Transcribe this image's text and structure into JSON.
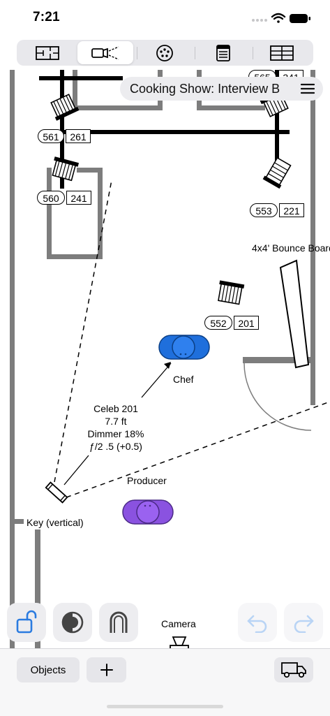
{
  "status_bar": {
    "time": "7:21"
  },
  "tabs": [
    {
      "icon": "floor-plan-icon",
      "selected": false
    },
    {
      "icon": "spotlight-icon",
      "selected": true
    },
    {
      "icon": "dmx-connector-icon",
      "selected": false
    },
    {
      "icon": "document-list-icon",
      "selected": false
    },
    {
      "icon": "table-grid-icon",
      "selected": false
    }
  ],
  "header": {
    "title": "Cooking Show: Interview B"
  },
  "fixtures": [
    {
      "channel": "565",
      "dimmer": "341"
    },
    {
      "channel": "561",
      "dimmer": "261"
    },
    {
      "channel": "560",
      "dimmer": "241"
    },
    {
      "channel": "553",
      "dimmer": "221"
    },
    {
      "channel": "552",
      "dimmer": "201"
    }
  ],
  "labels": {
    "bounce": "4x4' Bounce Board",
    "chef": "Chef",
    "producer": "Producer",
    "key": "Key (vertical)",
    "camera": "Camera"
  },
  "annotation": {
    "line1": "Celeb 201",
    "line2": "7.7 ft",
    "line3": "Dimmer 18%",
    "line4": "ƒ/2 .5 (+0.5)"
  },
  "people_colors": {
    "chef": "#1f6fdc",
    "producer": "#8a52e0"
  },
  "toolbar": {
    "lock": "unlock-icon",
    "contrast": "contrast-icon",
    "magnet": "magnet-icon",
    "undo": "undo-icon",
    "redo": "redo-icon"
  },
  "bottom": {
    "objects_label": "Objects",
    "add": "+",
    "truck": "truck-icon"
  },
  "accent": "#2a7be0"
}
